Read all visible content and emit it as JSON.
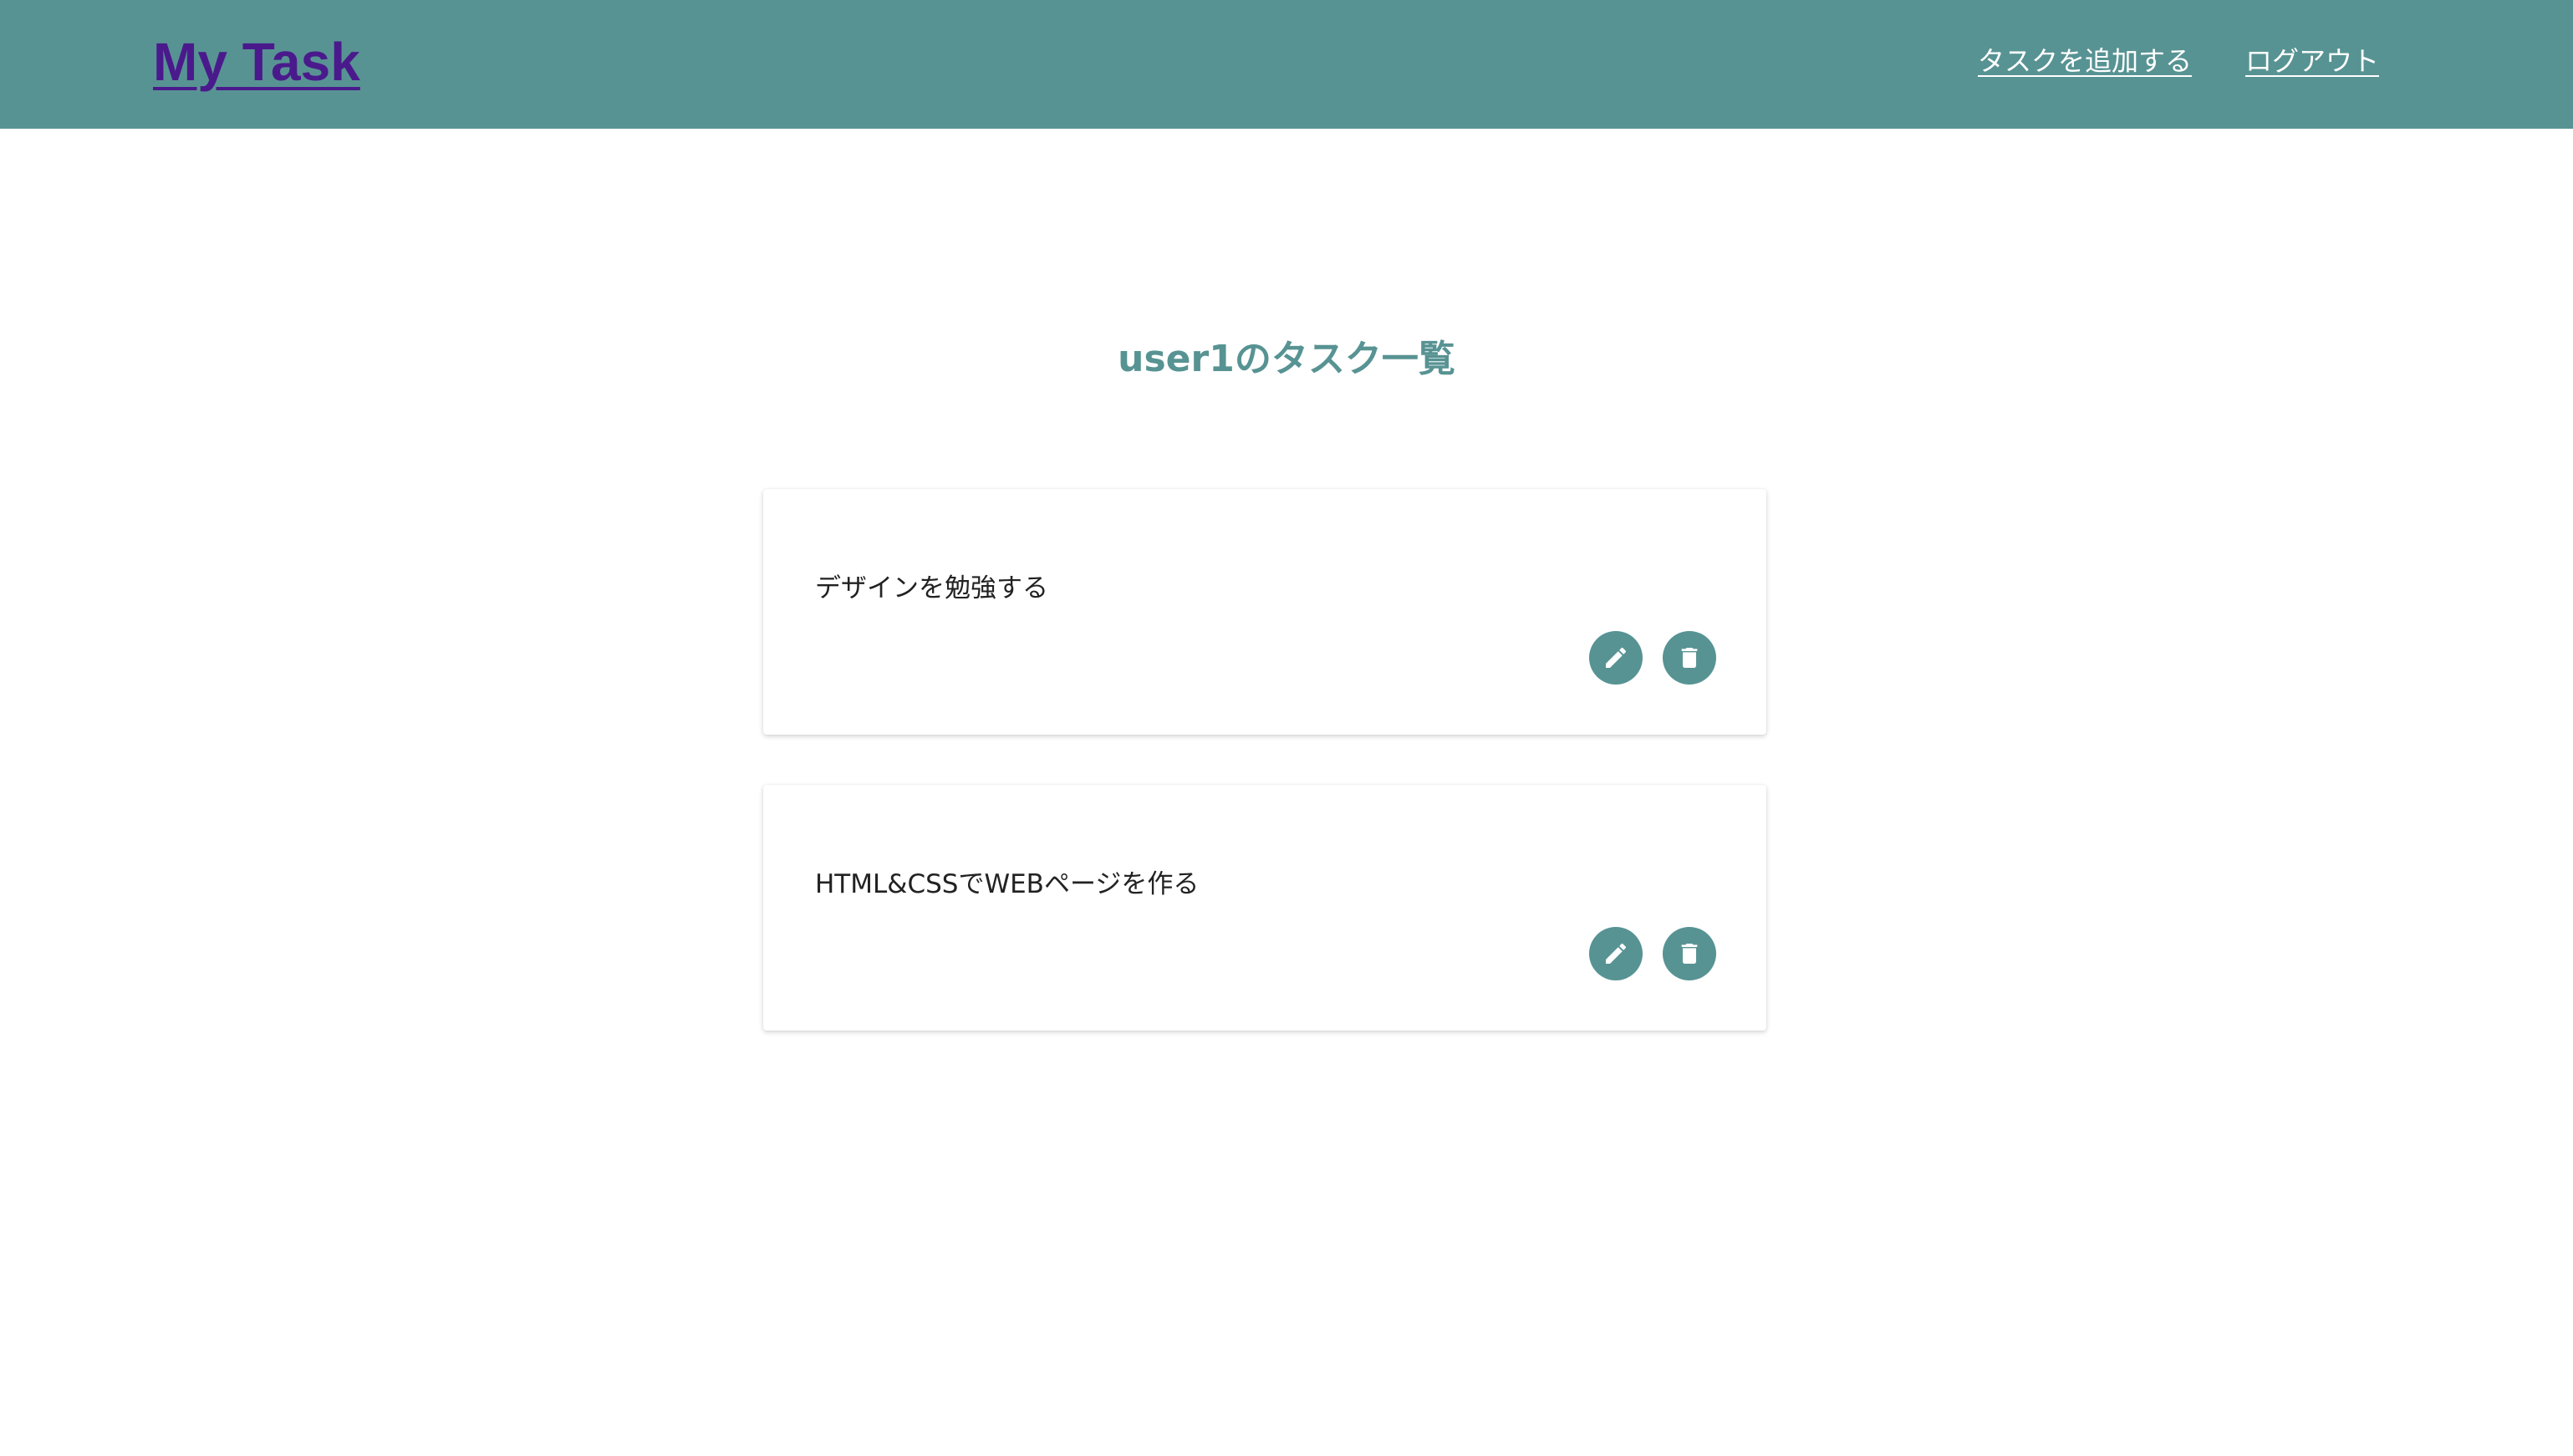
{
  "header": {
    "brand": "My Task",
    "nav": {
      "add_task": "タスクを追加する",
      "logout": "ログアウト"
    }
  },
  "main": {
    "title": "user1のタスク一覧",
    "tasks": [
      {
        "text": "デザインを勉強する",
        "edit_icon": "edit-icon",
        "delete_icon": "trash-icon"
      },
      {
        "text": "HTML&CSSでWEBページを作る",
        "edit_icon": "edit-icon",
        "delete_icon": "trash-icon"
      }
    ]
  },
  "colors": {
    "primary": "#589393",
    "brand_link": "#4a1a8c",
    "text": "#222222",
    "background": "#ffffff"
  }
}
